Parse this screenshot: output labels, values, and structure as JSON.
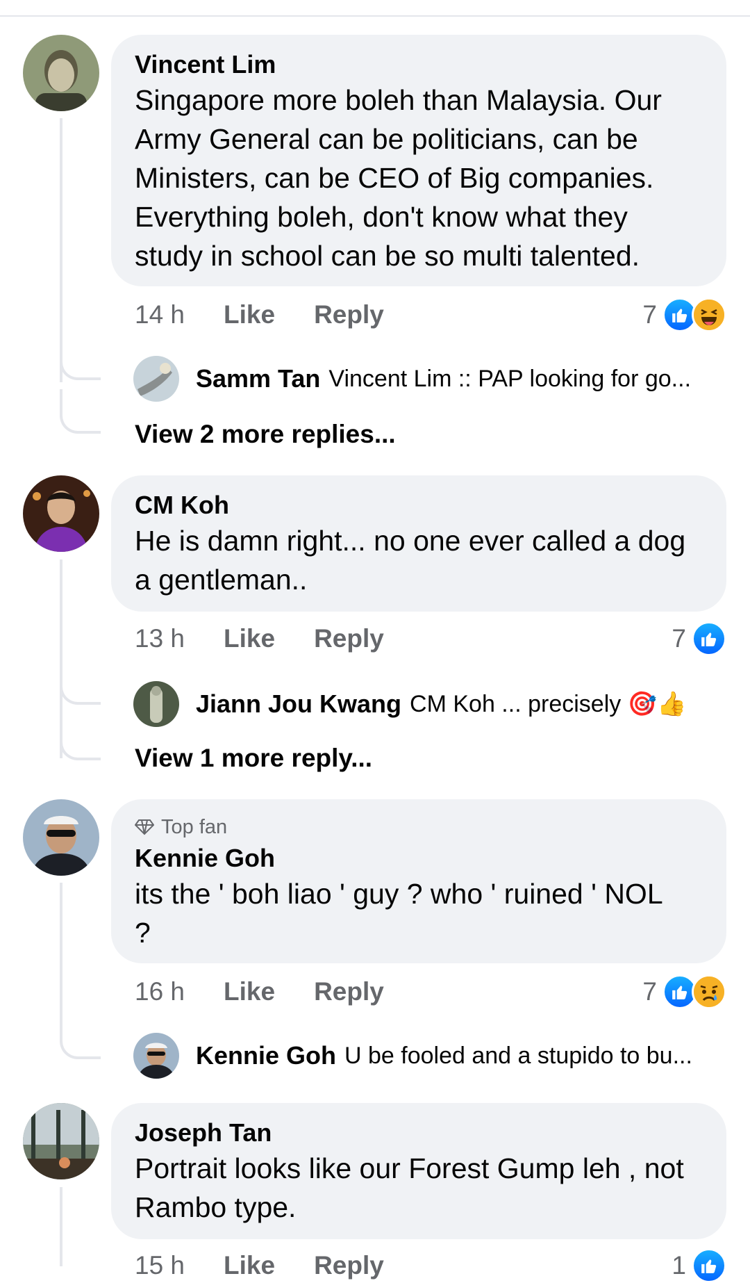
{
  "comments": [
    {
      "author": "Vincent Lim",
      "text": "Singapore more boleh than Malaysia. Our Army General can be politicians,  can be Ministers, can be CEO of Big companies. Everything boleh, don't know what they study in school can be so multi talented.",
      "time": "14 h",
      "like": "Like",
      "reply": "Reply",
      "reaction_count": "7",
      "reactions": [
        "like-icon",
        "haha-icon"
      ],
      "reply_preview": {
        "author": "Samm Tan",
        "text": "Vincent Lim :: PAP looking for go..."
      },
      "more_replies": "View 2 more replies..."
    },
    {
      "author": "CM Koh",
      "text": "He is damn right... no one ever called a dog a gentleman..",
      "time": "13 h",
      "like": "Like",
      "reply": "Reply",
      "reaction_count": "7",
      "reactions": [
        "like-icon"
      ],
      "reply_preview": {
        "author": "Jiann Jou Kwang",
        "text": "CM Koh ... precisely 🎯👍"
      },
      "more_replies": "View 1 more reply..."
    },
    {
      "badge": "Top fan",
      "author": "Kennie Goh",
      "text": "its the ' boh liao ' guy ? who ' ruined ' NOL ?",
      "time": "16 h",
      "like": "Like",
      "reply": "Reply",
      "reaction_count": "7",
      "reactions": [
        "like-icon",
        "sad-icon"
      ],
      "reply_preview": {
        "author": "Kennie Goh",
        "text": "U be fooled and a stupido to bu..."
      }
    },
    {
      "author": "Joseph Tan",
      "text": "Portrait looks like our Forest Gump leh , not  Rambo type.",
      "time": "15 h",
      "like": "Like",
      "reply": "Reply",
      "reaction_count": "1",
      "reactions": [
        "like-icon"
      ]
    }
  ],
  "colors": {
    "bubble": "#f0f2f5",
    "secondary_text": "#65676b",
    "like_blue": "#1877f2",
    "thread_line": "#e4e6eb"
  }
}
